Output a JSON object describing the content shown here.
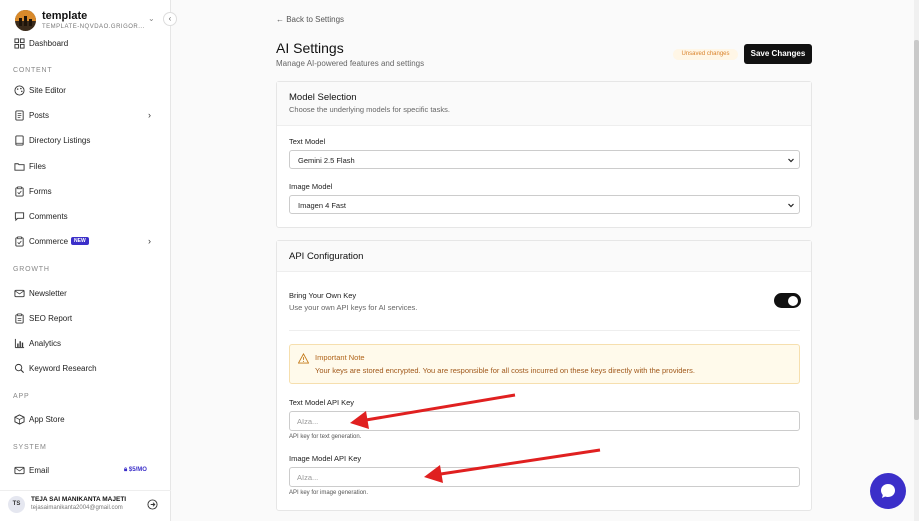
{
  "site": {
    "name": "template",
    "subdomain": "TEMPLATE-NQVDAO.GRIGOR...",
    "collapse_icon": "chevron-left-icon"
  },
  "sidebar": {
    "dashboard": "Dashboard",
    "sections": {
      "content": "CONTENT",
      "growth": "GROWTH",
      "app": "APP",
      "system": "SYSTEM"
    },
    "items": {
      "site_editor": "Site Editor",
      "posts": "Posts",
      "directory_listings": "Directory Listings",
      "files": "Files",
      "forms": "Forms",
      "comments": "Comments",
      "commerce": "Commerce",
      "commerce_badge": "NEW",
      "newsletter": "Newsletter",
      "seo_report": "SEO Report",
      "analytics": "Analytics",
      "keyword_research": "Keyword Research",
      "app_store": "App Store",
      "email": "Email",
      "email_badge": "$5/MO"
    }
  },
  "user": {
    "initials": "TS",
    "name": "TEJA SAI MANIKANTA MAJETI",
    "email": "tejasaimanikanta2004@gmail.com"
  },
  "header": {
    "back_link": "← Back to Settings",
    "title": "AI Settings",
    "subtitle": "Manage AI-powered features and settings",
    "unsaved": "Unsaved changes",
    "save_button": "Save Changes"
  },
  "model_selection": {
    "title": "Model Selection",
    "description": "Choose the underlying models for specific tasks.",
    "text_model_label": "Text Model",
    "text_model_value": "Gemini 2.5 Flash",
    "image_model_label": "Image Model",
    "image_model_value": "Imagen 4 Fast"
  },
  "api_config": {
    "title": "API Configuration",
    "byok_title": "Bring Your Own Key",
    "byok_desc": "Use your own API keys for AI services.",
    "byok_enabled": true,
    "note_title": "Important Note",
    "note_body": "Your keys are stored encrypted. You are responsible for all costs incurred on these keys directly with the providers.",
    "text_key_label": "Text Model API Key",
    "text_key_placeholder": "AIza...",
    "text_key_help": "API key for text generation.",
    "image_key_label": "Image Model API Key",
    "image_key_placeholder": "AIza...",
    "image_key_help": "API key for image generation."
  },
  "colors": {
    "accent": "#3b2fc9",
    "warning": "#d9822b",
    "annotation_arrow": "#e02020"
  }
}
